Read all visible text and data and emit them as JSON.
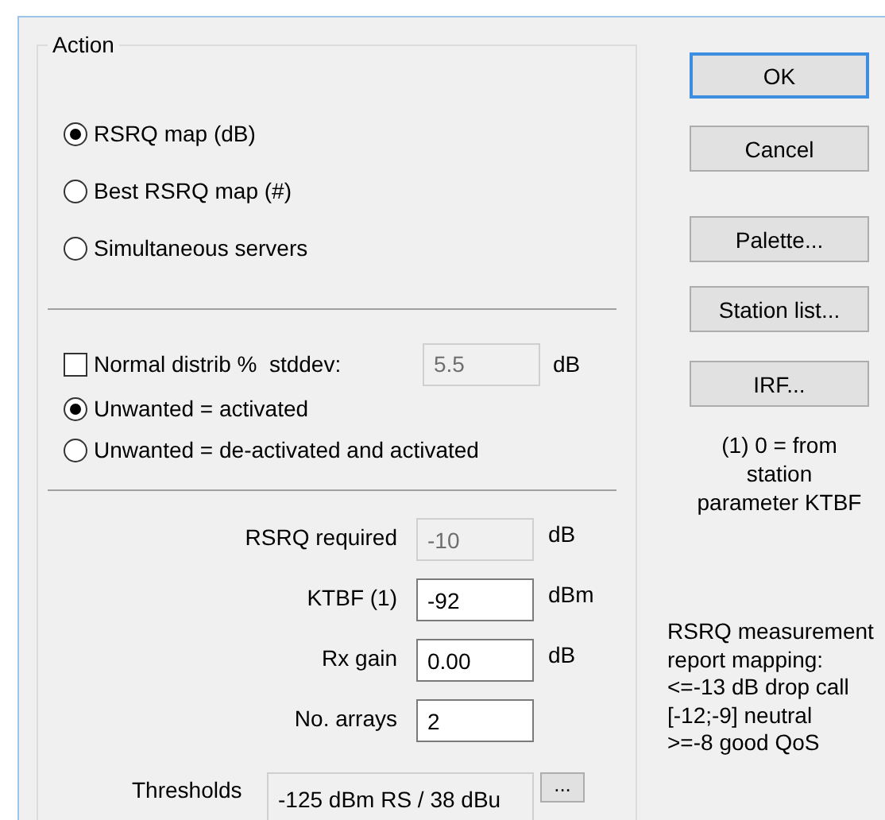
{
  "group": {
    "title": "Action"
  },
  "map_options": [
    {
      "label": "RSRQ map (dB)",
      "selected": true
    },
    {
      "label": "Best RSRQ map (#)",
      "selected": false
    },
    {
      "label": "Simultaneous servers",
      "selected": false
    }
  ],
  "normal_distrib": {
    "label": "Normal distrib %  stddev:",
    "checked": false,
    "value": "5.5",
    "disabled": true,
    "unit": "dB"
  },
  "unwanted_options": [
    {
      "label": "Unwanted = activated",
      "selected": true
    },
    {
      "label": "Unwanted = de-activated and activated",
      "selected": false
    }
  ],
  "parameters": [
    {
      "label": "RSRQ required",
      "value": "-10",
      "disabled": true,
      "unit": "dB"
    },
    {
      "label": "KTBF (1)",
      "value": "-92",
      "disabled": false,
      "unit": "dBm"
    },
    {
      "label": "Rx gain",
      "value": "0.00",
      "disabled": false,
      "unit": "dB"
    },
    {
      "label": "No. arrays",
      "value": "2",
      "disabled": false
    }
  ],
  "thresholds": {
    "label": "Thresholds",
    "value": "-125 dBm RS / 38 dBu",
    "button": "..."
  },
  "buttons": [
    {
      "label": "OK",
      "default": true
    },
    {
      "label": "Cancel",
      "default": false
    },
    {
      "label": "Palette...",
      "default": false
    },
    {
      "label": "Station list...",
      "default": false
    },
    {
      "label": "IRF...",
      "default": false
    }
  ],
  "footnote": [
    "(1) 0 = from",
    "station",
    "parameter KTBF"
  ],
  "mapping_note": [
    "RSRQ measurement",
    "report mapping:",
    "<=-13 dB drop call",
    "[-12;-9] neutral",
    ">=-8 good QoS"
  ]
}
